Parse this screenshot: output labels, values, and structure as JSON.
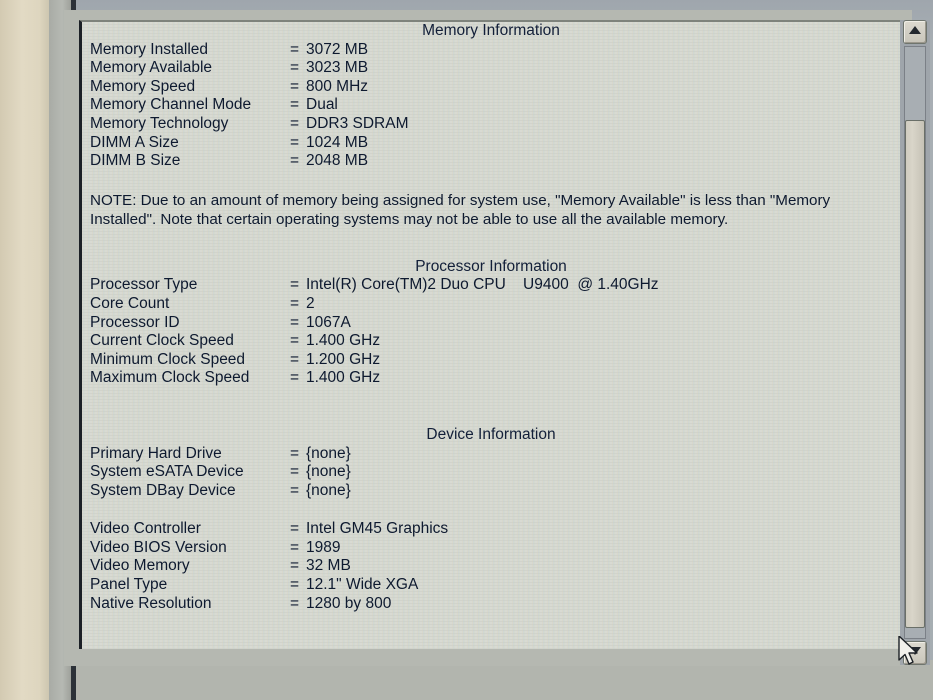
{
  "window": {
    "panel_background": "#d8dad3",
    "text_color": "#0e1a30",
    "chassis_color": "#a7aeb3"
  },
  "sections": [
    {
      "id": "memory",
      "title": "Memory Information",
      "rows": [
        {
          "label": "Memory Installed",
          "eq": "=",
          "value": "3072 MB"
        },
        {
          "label": "Memory Available",
          "eq": "=",
          "value": "3023 MB"
        },
        {
          "label": "Memory Speed",
          "eq": "=",
          "value": "800 MHz"
        },
        {
          "label": "Memory Channel Mode",
          "eq": "=",
          "value": "Dual"
        },
        {
          "label": "Memory Technology",
          "eq": "=",
          "value": "DDR3 SDRAM"
        },
        {
          "label": "DIMM A Size",
          "eq": "=",
          "value": "1024 MB"
        },
        {
          "label": "DIMM B Size",
          "eq": "=",
          "value": "2048 MB"
        }
      ],
      "note": "NOTE: Due to an amount of memory being assigned for system use, \"Memory Available\" is less than \"Memory Installed\". Note that certain operating systems may not be able to use all the available memory."
    },
    {
      "id": "processor",
      "title": "Processor Information",
      "rows": [
        {
          "label": "Processor Type",
          "eq": "=",
          "value": "Intel(R) Core(TM)2 Duo CPU    U9400  @ 1.40GHz"
        },
        {
          "label": "Core Count",
          "eq": "=",
          "value": "2"
        },
        {
          "label": "Processor ID",
          "eq": "=",
          "value": "1067A"
        },
        {
          "label": "Current Clock Speed",
          "eq": "=",
          "value": "1.400 GHz"
        },
        {
          "label": "Minimum Clock Speed",
          "eq": "=",
          "value": "1.200 GHz"
        },
        {
          "label": "Maximum Clock Speed",
          "eq": "=",
          "value": "1.400 GHz"
        }
      ]
    },
    {
      "id": "device",
      "title": "Device Information",
      "group_a": [
        {
          "label": "Primary Hard Drive",
          "eq": "=",
          "value": "{none}"
        },
        {
          "label": "System eSATA Device",
          "eq": "=",
          "value": "{none}"
        },
        {
          "label": "System DBay Device",
          "eq": "=",
          "value": "{none}"
        }
      ],
      "group_b": [
        {
          "label": "Video Controller",
          "eq": "=",
          "value": "Intel GM45 Graphics"
        },
        {
          "label": "Video BIOS Version",
          "eq": "=",
          "value": "1989"
        },
        {
          "label": "Video Memory",
          "eq": "=",
          "value": "32 MB"
        },
        {
          "label": "Panel Type",
          "eq": "=",
          "value": "12.1\" Wide XGA"
        },
        {
          "label": "Native Resolution",
          "eq": "=",
          "value": "1280 by 800"
        }
      ]
    }
  ],
  "scrollbar": {
    "up_icon": "triangle-up-icon",
    "down_icon": "triangle-down-icon",
    "thumb_label": "scrollbar-thumb",
    "orientation": "vertical"
  },
  "cursor": {
    "icon": "mouse-pointer-icon"
  }
}
